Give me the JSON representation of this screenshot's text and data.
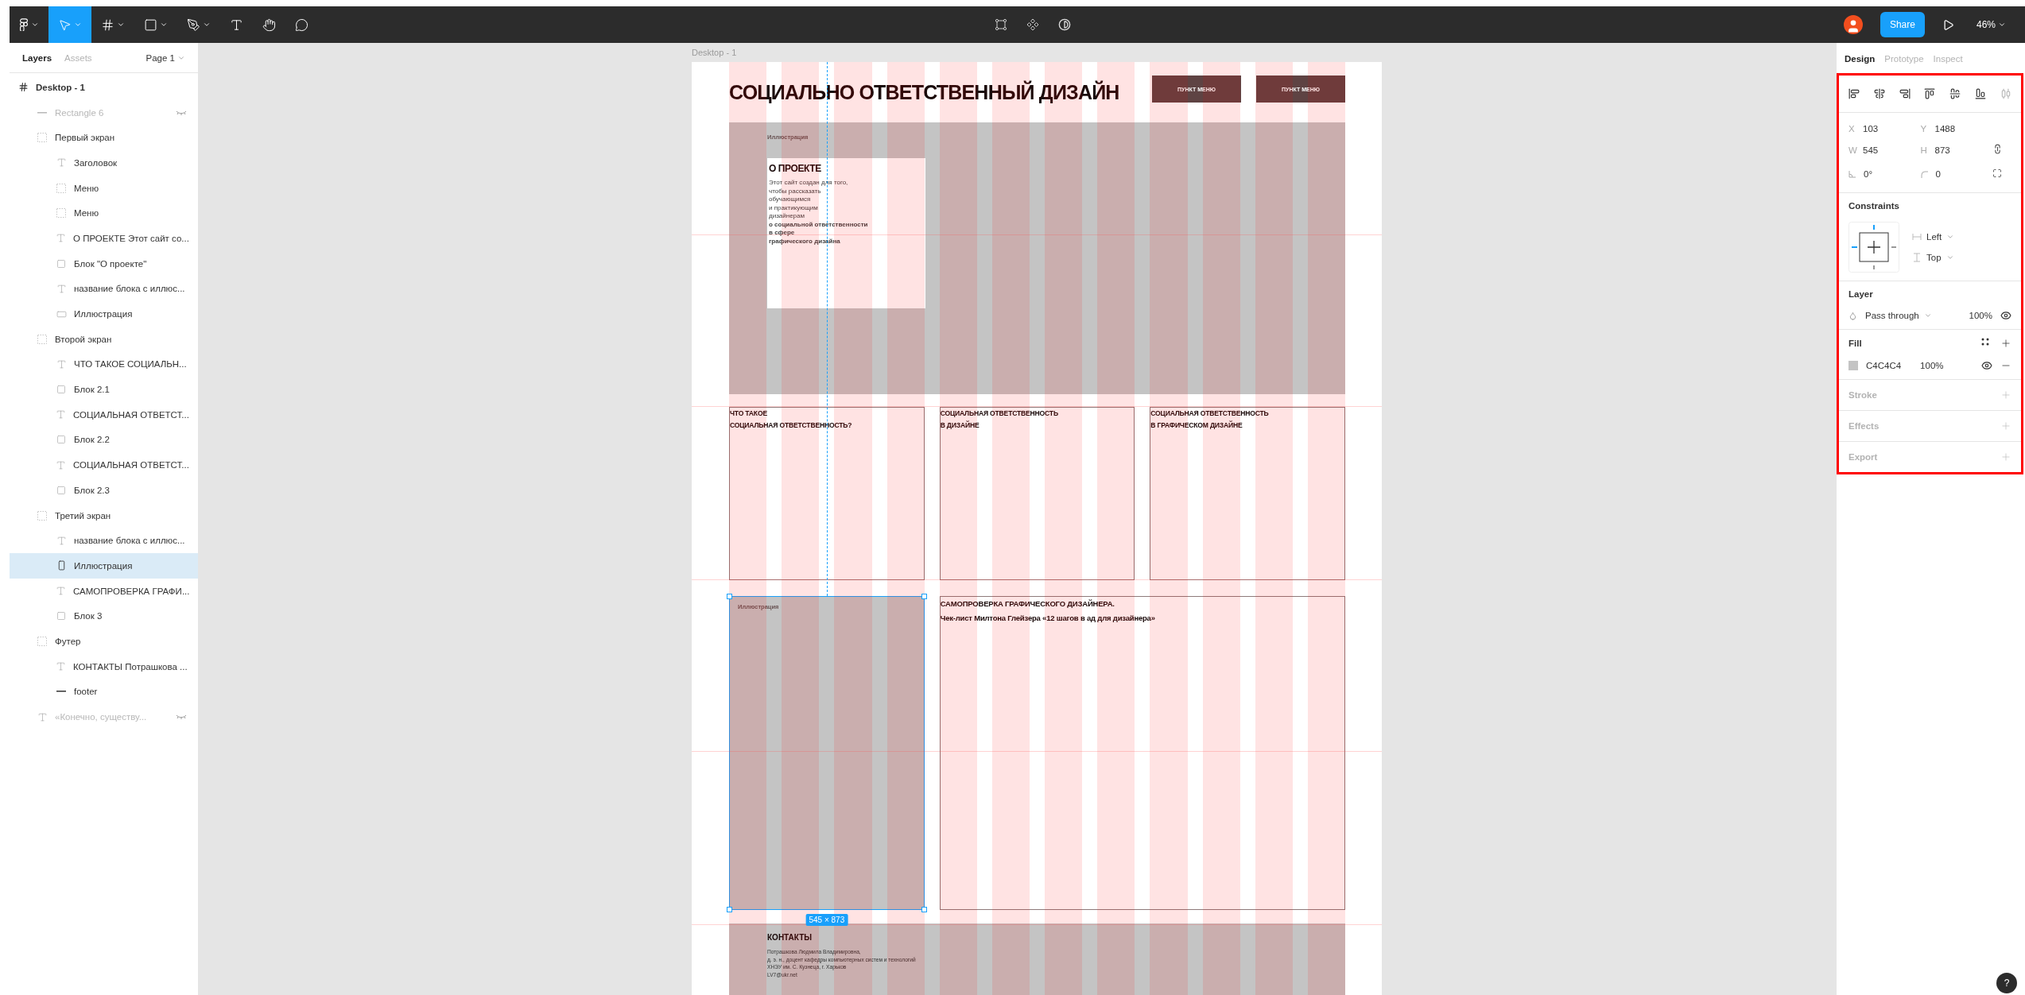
{
  "toolbar": {
    "tools": [
      {
        "kind": "main-menu",
        "selected": false
      },
      {
        "kind": "move",
        "selected": true
      },
      {
        "kind": "frame",
        "selected": false
      },
      {
        "kind": "shape",
        "selected": false
      },
      {
        "kind": "pen",
        "selected": false
      },
      {
        "kind": "text",
        "selected": false
      },
      {
        "kind": "hand",
        "selected": false
      },
      {
        "kind": "comment",
        "selected": false
      }
    ],
    "share": "Share",
    "zoom": "46%"
  },
  "left_panel": {
    "tabs": [
      {
        "label": "Layers",
        "selected": true
      },
      {
        "label": "Assets",
        "selected": false
      }
    ],
    "page": "Page 1",
    "layers": [
      {
        "name": "Desktop - 1",
        "kind": "frame",
        "hidden": false,
        "selected": false,
        "children": [
          {
            "name": "Rectangle 6",
            "kind": "line",
            "hidden": true,
            "selected": false
          },
          {
            "name": "Первый экран",
            "kind": "group",
            "hidden": false,
            "selected": false,
            "children": [
              {
                "name": "Заголовок",
                "kind": "text",
                "hidden": false,
                "selected": false
              },
              {
                "name": "Меню",
                "kind": "group",
                "hidden": false,
                "selected": false
              },
              {
                "name": "Меню",
                "kind": "group",
                "hidden": false,
                "selected": false
              },
              {
                "name": "О ПРОЕКТЕ Этот сайт со...",
                "kind": "text",
                "hidden": false,
                "selected": false
              },
              {
                "name": "Блок \"О проекте\"",
                "kind": "rect",
                "hidden": false,
                "selected": false
              },
              {
                "name": "название блока с иллюс...",
                "kind": "text",
                "hidden": false,
                "selected": false
              },
              {
                "name": "Иллюстрация",
                "kind": "rect-wide",
                "hidden": false,
                "selected": false
              }
            ]
          },
          {
            "name": "Второй экран",
            "kind": "group",
            "hidden": false,
            "selected": false,
            "children": [
              {
                "name": "ЧТО ТАКОЕ СОЦИАЛЬН...",
                "kind": "text",
                "hidden": false,
                "selected": false
              },
              {
                "name": "Блок 2.1",
                "kind": "rect",
                "hidden": false,
                "selected": false
              },
              {
                "name": "СОЦИАЛЬНАЯ ОТВЕТСТ...",
                "kind": "text",
                "hidden": false,
                "selected": false
              },
              {
                "name": "Блок 2.2",
                "kind": "rect",
                "hidden": false,
                "selected": false
              },
              {
                "name": "СОЦИАЛЬНАЯ ОТВЕТСТ...",
                "kind": "text",
                "hidden": false,
                "selected": false
              },
              {
                "name": "Блок 2.3",
                "kind": "rect",
                "hidden": false,
                "selected": false
              }
            ]
          },
          {
            "name": "Третий экран",
            "kind": "group",
            "hidden": false,
            "selected": false,
            "children": [
              {
                "name": "название блока с иллюс...",
                "kind": "text",
                "hidden": false,
                "selected": false
              },
              {
                "name": "Иллюстрация",
                "kind": "rect-tall",
                "hidden": false,
                "selected": true
              },
              {
                "name": "САМОПРОВЕРКА ГРАФИ...",
                "kind": "text",
                "hidden": false,
                "selected": false
              },
              {
                "name": "Блок 3",
                "kind": "rect",
                "hidden": false,
                "selected": false
              }
            ]
          },
          {
            "name": "Футер",
            "kind": "group",
            "hidden": false,
            "selected": false,
            "children": [
              {
                "name": "КОНТАКТЫ Потрашкова ...",
                "kind": "text",
                "hidden": false,
                "selected": false
              },
              {
                "name": "footer",
                "kind": "line",
                "hidden": false,
                "selected": false
              }
            ]
          },
          {
            "name": "«Конечно, существу...",
            "kind": "text",
            "hidden": true,
            "selected": false
          }
        ]
      }
    ]
  },
  "canvas": {
    "frame_label": "Desktop - 1",
    "header": {
      "title": "СОЦИАЛЬНО ОТВЕТСТВЕННЫЙ ДИЗАЙН",
      "menu": [
        "ПУНКТ МЕНЮ",
        "ПУНКТ МЕНЮ"
      ]
    },
    "hero": {
      "label": "Иллюстрация",
      "card_title": "О ПРОЕКТЕ",
      "card_body": "Этот сайт создан для того,\nчтобы рассказать\nобучающимся\nи практикующим\nдизайнерам\n**о социальной ответственности**\n**в сфере**\n**графического дизайна**"
    },
    "blocks": [
      {
        "title": "ЧТО ТАКОЕ\nСОЦИАЛЬНАЯ ОТВЕТСТВЕННОСТЬ?"
      },
      {
        "title": "СОЦИАЛЬНАЯ ОТВЕТСТВЕННОСТЬ\nВ ДИЗАЙНЕ"
      },
      {
        "title": "СОЦИАЛЬНАЯ ОТВЕТСТВЕННОСТЬ\nВ ГРАФИЧЕСКОМ ДИЗАЙНЕ"
      }
    ],
    "third": {
      "label": "Иллюстрация",
      "selected": true,
      "size": "545 × 873",
      "title": "САМОПРОВЕРКА ГРАФИЧЕСКОГО ДИЗАЙНЕРА.\nЧек-лист Милтона Глейзера «12 шагов в ад для дизайнера»"
    },
    "footer": {
      "title": "КОНТАКТЫ",
      "body": "Потрашкова Людмила Владимировна,\nд. э. н., доцент кафедры компьютерных систем и технологий\nХНЭУ им. С. Кузнеца, г. Харьков\nLV7@ukr.net"
    }
  },
  "right_panel": {
    "tabs": [
      {
        "label": "Design",
        "selected": true
      },
      {
        "label": "Prototype",
        "selected": false
      },
      {
        "label": "Inspect",
        "selected": false
      }
    ],
    "fields": [
      {
        "kind": "label",
        "label": "X",
        "value": "103"
      },
      {
        "kind": "label",
        "label": "Y",
        "value": "1488"
      },
      {
        "kind": "label",
        "label": "W",
        "value": "545"
      },
      {
        "kind": "label",
        "label": "H",
        "value": "873"
      },
      {
        "kind": "angle",
        "value": "0°"
      },
      {
        "kind": "radius",
        "value": "0"
      }
    ],
    "constraints": {
      "title": "Constraints",
      "horizontal": "Left",
      "vertical": "Top"
    },
    "layer": {
      "title": "Layer",
      "blend": "Pass through",
      "opacity": "100%"
    },
    "fill": {
      "title": "Fill",
      "items": [
        {
          "hex": "C4C4C4",
          "opacity": "100%"
        }
      ]
    },
    "sections": [
      "Stroke",
      "Effects",
      "Export"
    ]
  },
  "help": "?"
}
